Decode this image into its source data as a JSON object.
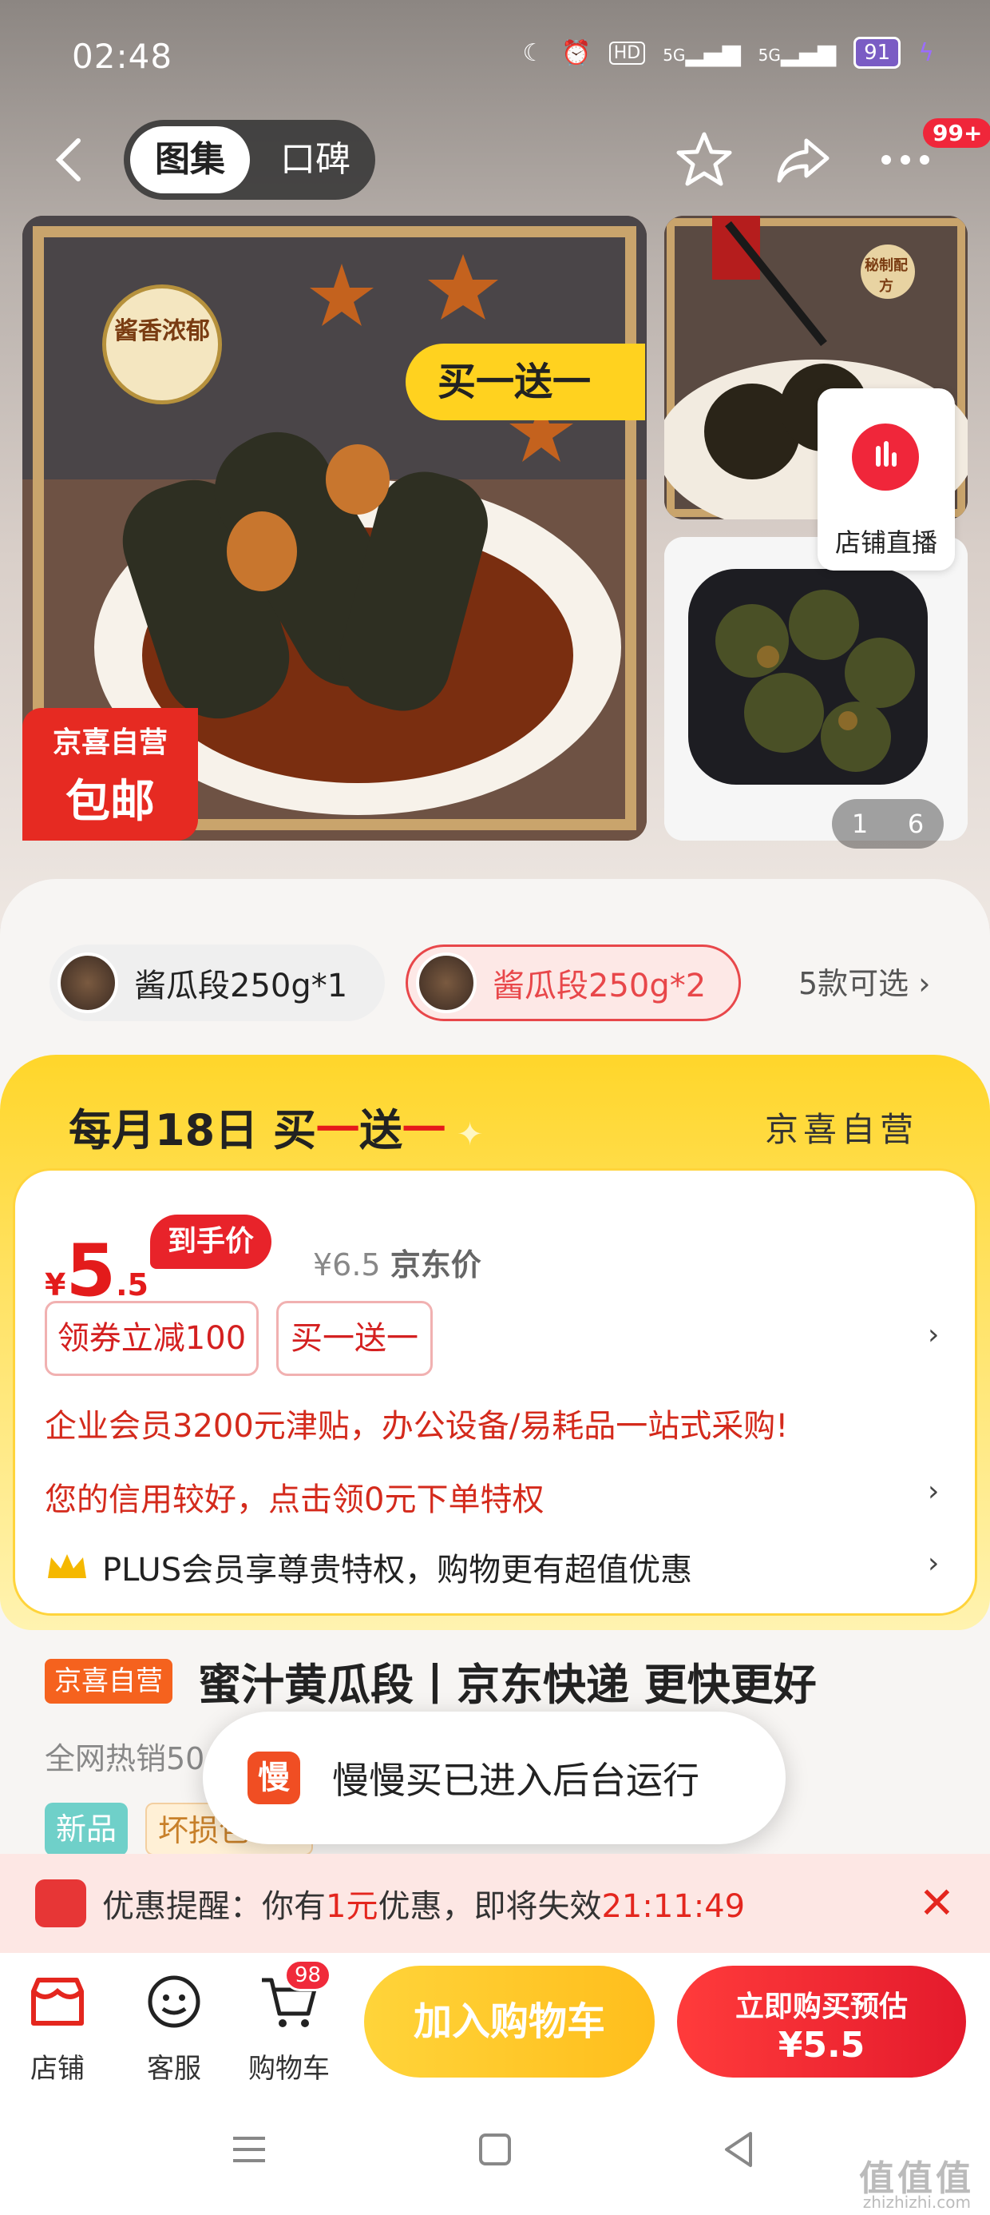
{
  "status": {
    "time": "02:48",
    "battery": "91",
    "signal1": "5G",
    "signal2": "5G",
    "hd": "HD"
  },
  "nav": {
    "tab_gallery": "图集",
    "tab_reviews": "口碑",
    "more_badge": "99+"
  },
  "gallery": {
    "main_badge_top": "京喜自营",
    "main_badge_bottom": "包邮",
    "main_promo": "买一送一",
    "main_seal": "酱香浓郁",
    "side_seal": "秘制配方",
    "live_label": "店铺直播",
    "pager_current": "1",
    "pager_total": "6"
  },
  "variants": [
    {
      "label": "酱瓜段250g*1"
    },
    {
      "label": "酱瓜段250g*2"
    }
  ],
  "variants_more": "5款可选",
  "promo": {
    "header_plain": "每月18日 买",
    "header_red1": "一",
    "header_plain2": "送",
    "header_red2": "一",
    "self_label": "京喜自营",
    "price_symbol": "¥",
    "price_int": "5",
    "price_dec": ".5",
    "price_tag": "到手价",
    "jd_price": "¥6.5",
    "jd_price_label": "京东价",
    "coupon1": "领券立减100",
    "coupon2": "买一送一",
    "enterprise": "企业会员3200元津贴，办公设备/易耗品一站式采购!",
    "credit": "您的信用较好，点击领0元下单特权",
    "plus": "PLUS会员享尊贵特权，购物更有超值优惠"
  },
  "product": {
    "self_tag": "京喜自营",
    "title": "蜜汁黄瓜段丨京东快递 更快更好",
    "subtitle": "全网热销50",
    "tags": [
      "新品",
      "坏损包"
    ]
  },
  "toast": {
    "logo": "慢",
    "text": "慢慢买已进入后台运行"
  },
  "reminder": {
    "pre": "优惠提醒：你有",
    "amount": "1元",
    "mid": "优惠，即将失效",
    "countdown": "21:11:49"
  },
  "bottom": {
    "shop": "店铺",
    "service": "客服",
    "cart": "购物车",
    "cart_count": "98",
    "add_cart": "加入购物车",
    "buy_now_line1": "立即购买预估",
    "buy_now_line2": "¥5.5"
  },
  "watermark": {
    "main": "值值值",
    "sub": "zhizhizhi.com"
  },
  "colors": {
    "accent_red": "#e4261e",
    "promo_yellow": "#ffd62a",
    "brand_orange": "#f5621e"
  }
}
